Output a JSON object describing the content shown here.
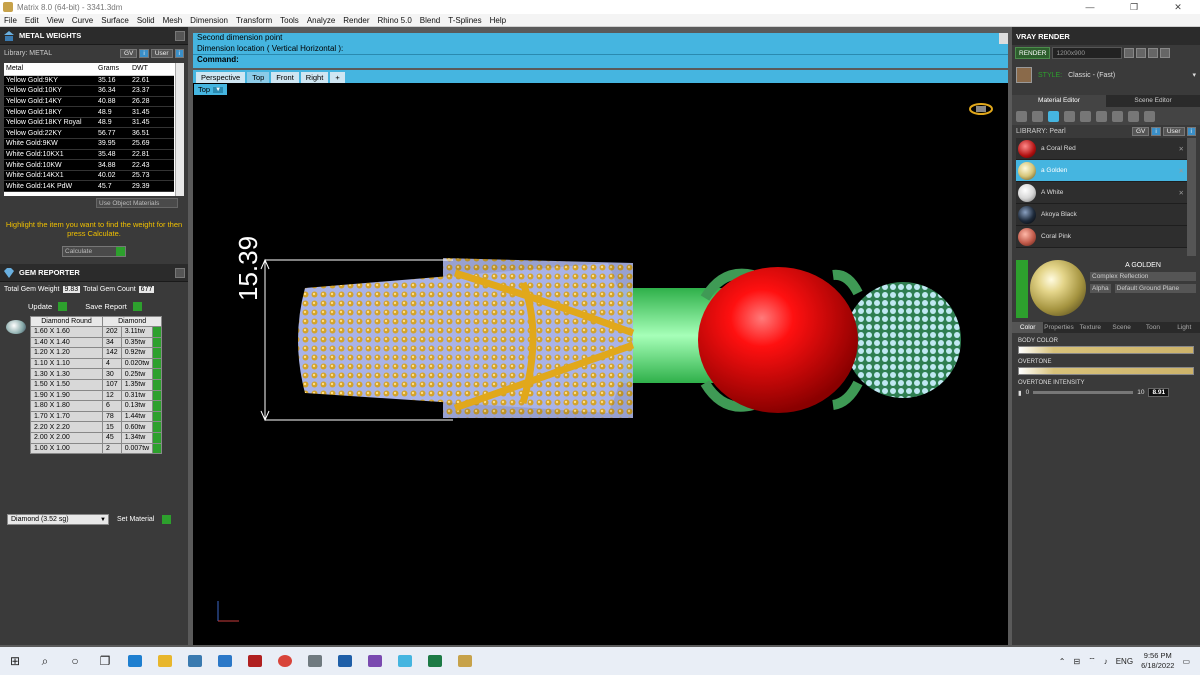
{
  "window": {
    "title": "Matrix 8.0 (64-bit) - 3341.3dm",
    "minimize": "—",
    "maximize": "❐",
    "close": "✕"
  },
  "menu": [
    "File",
    "Edit",
    "View",
    "Curve",
    "Surface",
    "Solid",
    "Mesh",
    "Dimension",
    "Transform",
    "Tools",
    "Analyze",
    "Render",
    "Rhino 5.0",
    "Blend",
    "T-Splines",
    "Help"
  ],
  "metal_weights": {
    "title": "METAL WEIGHTS",
    "library_label": "Library: METAL",
    "gv_label": "GV",
    "user_label": "User",
    "columns": [
      "Metal",
      "Grams",
      "DWT"
    ],
    "rows": [
      [
        "Yellow Gold:9KY",
        "35.16",
        "22.61"
      ],
      [
        "Yellow Gold:10KY",
        "36.34",
        "23.37"
      ],
      [
        "Yellow Gold:14KY",
        "40.88",
        "26.28"
      ],
      [
        "Yellow Gold:18KY",
        "48.9",
        "31.45"
      ],
      [
        "Yellow Gold:18KY Royal",
        "48.9",
        "31.45"
      ],
      [
        "Yellow Gold:22KY",
        "56.77",
        "36.51"
      ],
      [
        "White Gold:9KW",
        "39.95",
        "25.69"
      ],
      [
        "White Gold:10KX1",
        "35.48",
        "22.81"
      ],
      [
        "White Gold:10KW",
        "34.88",
        "22.43"
      ],
      [
        "White Gold:14KX1",
        "40.02",
        "25.73"
      ],
      [
        "White Gold:14K PdW",
        "45.7",
        "29.39"
      ]
    ],
    "use_object_materials": "Use Object Materials",
    "hint": "Highlight the item you want to find the weight for then press Calculate.",
    "calculate": "Calculate"
  },
  "gem_reporter": {
    "title": "GEM REPORTER",
    "total_weight_label": "Total Gem Weight",
    "total_weight": "9.83",
    "total_count_label": "Total Gem Count",
    "total_count": "677",
    "update": "Update",
    "save_report": "Save Report",
    "columns": [
      "Diamond Round",
      "Diamond"
    ],
    "rows": [
      [
        "1.60 X 1.60",
        "202",
        "3.11tw"
      ],
      [
        "1.40 X 1.40",
        "34",
        "0.35tw"
      ],
      [
        "1.20 X 1.20",
        "142",
        "0.92tw"
      ],
      [
        "1.10 X 1.10",
        "4",
        "0.020tw"
      ],
      [
        "1.30 X 1.30",
        "30",
        "0.25tw"
      ],
      [
        "1.50 X 1.50",
        "107",
        "1.35tw"
      ],
      [
        "1.90 X 1.90",
        "12",
        "0.31tw"
      ],
      [
        "1.80 X 1.80",
        "6",
        "0.13tw"
      ],
      [
        "1.70 X 1.70",
        "78",
        "1.44tw"
      ],
      [
        "2.20 X 2.20",
        "15",
        "0.60tw"
      ],
      [
        "2.00 X 2.00",
        "45",
        "1.34tw"
      ],
      [
        "1.00 X 1.00",
        "2",
        "0.007tw"
      ]
    ],
    "material_select": "Diamond    (3.52 sg)",
    "set_material": "Set Material"
  },
  "command": {
    "line1": "Second dimension point",
    "line2": "Dimension location ( Vertical  Horizontal ):",
    "label": "Command:"
  },
  "viewport": {
    "tabs": [
      "Perspective",
      "Top",
      "Front",
      "Right"
    ],
    "active_tab": "Top",
    "add_tab": "+",
    "current_view": "Top",
    "dimension_value": "15.39"
  },
  "vray": {
    "title": "VRAY RENDER",
    "render_button": "RENDER",
    "resolution": "1200x900",
    "style_label": "STYLE:",
    "style_value": "Classic - (Fast)",
    "tab_material_editor": "Material Editor",
    "tab_scene_editor": "Scene Editor",
    "library_label": "LIBRARY: Pearl",
    "gv_label": "GV",
    "user_label": "User",
    "materials": [
      {
        "name": "a Coral Red",
        "color": "#b01010"
      },
      {
        "name": "a Golden",
        "color": "#d6c67a"
      },
      {
        "name": "A White",
        "color": "#e8e8e8"
      },
      {
        "name": "Akoya Black",
        "color": "#1e2a3a"
      },
      {
        "name": "Coral Pink",
        "color": "#c05a4a"
      }
    ],
    "selected_name": "A GOLDEN",
    "complex_reflection": "Complex Reflection",
    "alpha": "Alpha",
    "ground_plane": "Default Ground Plane",
    "prop_tabs": [
      "Color",
      "Properties",
      "Texture",
      "Scene",
      "Toon",
      "Light"
    ],
    "body_color_label": "BODY COLOR",
    "overtone_label": "OVERTONE",
    "overtone_intensity_label": "OVERTONE INTENSITY",
    "intensity_min": "0",
    "intensity_max": "10",
    "intensity_value": "8.91"
  },
  "taskbar": {
    "language": "ENG",
    "time": "9:56 PM",
    "date": "6/18/2022"
  }
}
